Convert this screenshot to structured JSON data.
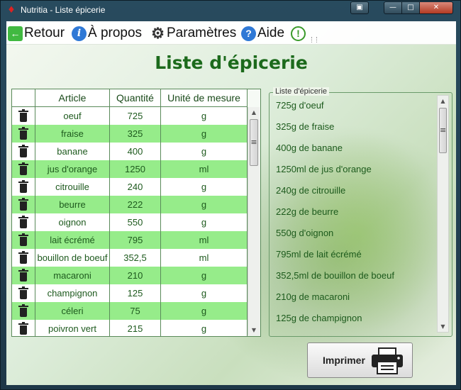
{
  "window": {
    "title": "Nutritia - Liste épicerie"
  },
  "toolbar": {
    "back_label": "Retour",
    "about_label": "À propos",
    "settings_label": "Paramètres",
    "help_label": "Aide"
  },
  "page": {
    "title": "Liste d'épicerie"
  },
  "grid": {
    "columns": [
      "Article",
      "Quantité",
      "Unité de mesure"
    ],
    "rows": [
      {
        "article": "oeuf",
        "quantite": "725",
        "unite": "g"
      },
      {
        "article": "fraise",
        "quantite": "325",
        "unite": "g"
      },
      {
        "article": "banane",
        "quantite": "400",
        "unite": "g"
      },
      {
        "article": "jus d'orange",
        "quantite": "1250",
        "unite": "ml"
      },
      {
        "article": "citrouille",
        "quantite": "240",
        "unite": "g"
      },
      {
        "article": "beurre",
        "quantite": "222",
        "unite": "g"
      },
      {
        "article": "oignon",
        "quantite": "550",
        "unite": "g"
      },
      {
        "article": "lait écrémé",
        "quantite": "795",
        "unite": "ml"
      },
      {
        "article": "bouillon de boeuf",
        "quantite": "352,5",
        "unite": "ml"
      },
      {
        "article": "macaroni",
        "quantite": "210",
        "unite": "g"
      },
      {
        "article": "champignon",
        "quantite": "125",
        "unite": "g"
      },
      {
        "article": "céleri",
        "quantite": "75",
        "unite": "g"
      },
      {
        "article": "poivron vert",
        "quantite": "215",
        "unite": "g"
      }
    ]
  },
  "summary": {
    "group_label": "Liste d'épicerie",
    "items": [
      "725g d'oeuf",
      "325g de fraise",
      "400g de banane",
      "1250ml de jus d'orange",
      "240g de citrouille",
      "222g de beurre",
      "550g d'oignon",
      "795ml de lait écrémé",
      "352,5ml de bouillon de boeuf",
      "210g de macaroni",
      "125g de champignon"
    ]
  },
  "print": {
    "label": "Imprimer"
  },
  "icons": {
    "back": "arrow-left-icon",
    "about": "info-icon",
    "settings": "gear-icon",
    "help": "question-icon",
    "warning": "exclamation-icon",
    "delete": "trash-icon",
    "print": "printer-icon"
  },
  "colors": {
    "accent_green": "#1c6a1c",
    "row_alt": "#96ec8a",
    "close_button": "#c75a44"
  }
}
